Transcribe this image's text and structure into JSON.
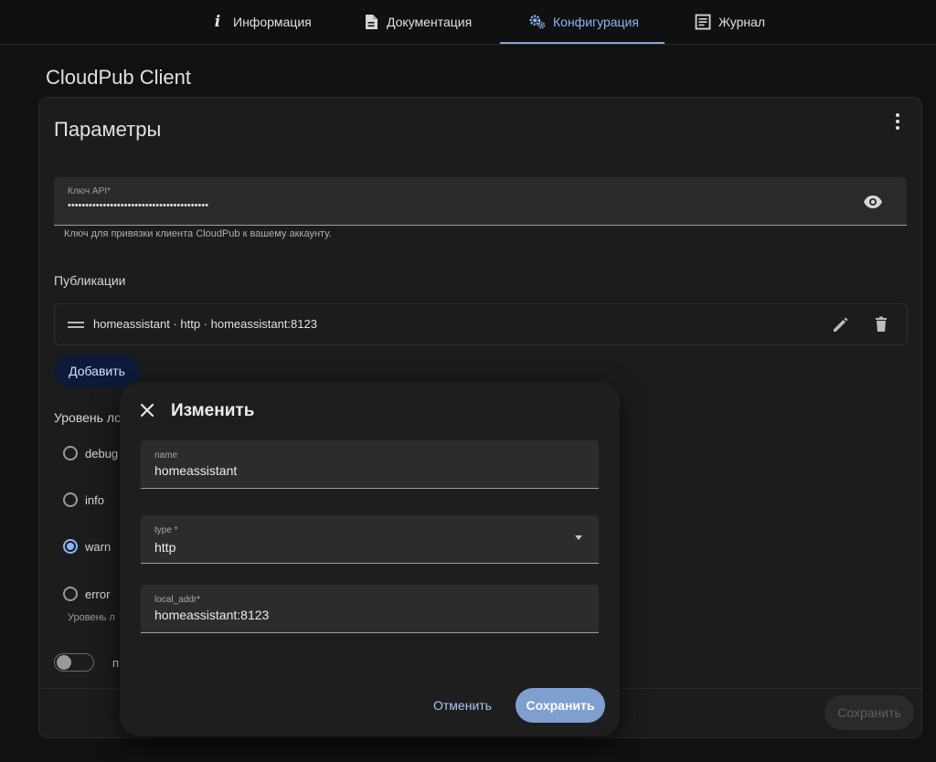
{
  "tabs": [
    {
      "label": "Информация",
      "icon": "info-icon"
    },
    {
      "label": "Документация",
      "icon": "document-icon"
    },
    {
      "label": "Конфигурация",
      "icon": "cogs-icon",
      "active": true
    },
    {
      "label": "Журнал",
      "icon": "log-icon"
    }
  ],
  "app_title": "CloudPub Client",
  "card": {
    "title": "Параметры",
    "api_key": {
      "label": "Ключ API*",
      "value": "••••••••••••••••••••••••••••••••••••••••",
      "helper": "Ключ для привязки клиента CloudPub к вашему аккаунту."
    },
    "publications_label": "Публикации",
    "publication_row": "homeassistant · http · homeassistant:8123",
    "add_label": "Добавить",
    "log_level_label": "Уровень ло",
    "log_levels": [
      {
        "label": "debug",
        "selected": false
      },
      {
        "label": "info",
        "selected": false
      },
      {
        "label": "warn",
        "selected": true
      },
      {
        "label": "error",
        "selected": false
      }
    ],
    "log_helper": "Уровень л",
    "toggle_label": "п",
    "save_label": "Сохранить"
  },
  "dialog": {
    "title": "Изменить",
    "fields": [
      {
        "label": "name",
        "value": "homeassistant"
      },
      {
        "label": "type *",
        "value": "http"
      },
      {
        "label": "local_addr*",
        "value": "homeassistant:8123"
      }
    ],
    "cancel_label": "Отменить",
    "save_label": "Сохранить"
  },
  "colors": {
    "accent": "#8ab4f8",
    "primary_button": "#7f9fcf",
    "background": "#111111",
    "card": "#1c1c1c"
  }
}
